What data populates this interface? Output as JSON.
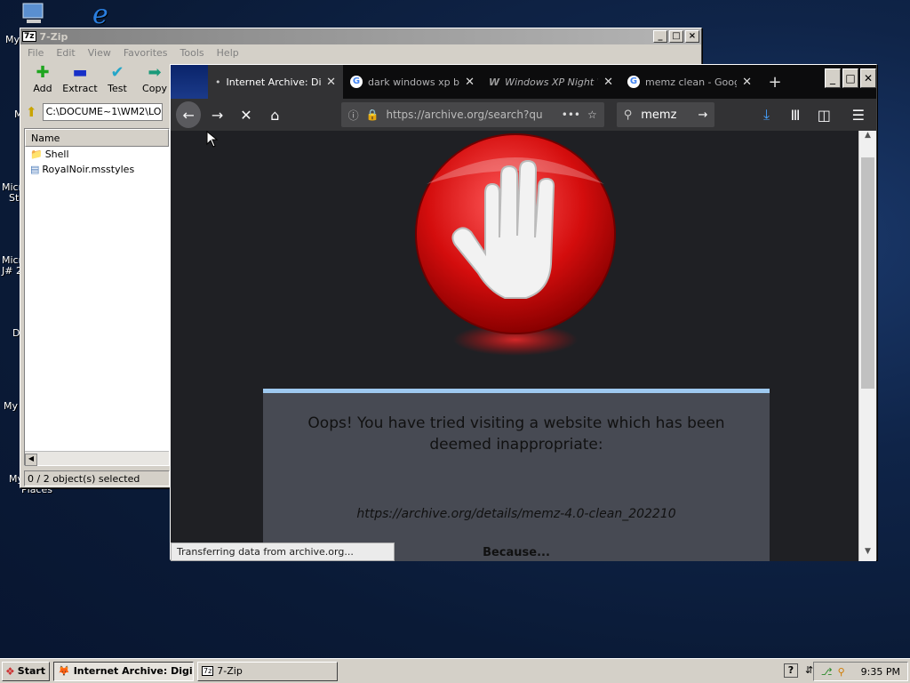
{
  "desktop": {
    "icons": [
      {
        "label": "My",
        "icon": "computer-icon"
      },
      {
        "label": "",
        "icon": "ie-icon"
      },
      {
        "label": "M"
      },
      {
        "label": "Micr"
      },
      {
        "label": "Stu"
      },
      {
        "label": "Micr"
      },
      {
        "label": "J# 2"
      },
      {
        "label": "D"
      },
      {
        "label": "My I"
      },
      {
        "label": "My"
      },
      {
        "label": "Places"
      }
    ]
  },
  "zip": {
    "title": "7-Zip",
    "menu": [
      "File",
      "Edit",
      "View",
      "Favorites",
      "Tools",
      "Help"
    ],
    "toolbar": [
      {
        "label": "Add",
        "icon": "plus-icon"
      },
      {
        "label": "Extract",
        "icon": "minus-icon"
      },
      {
        "label": "Test",
        "icon": "check-icon"
      },
      {
        "label": "Copy",
        "icon": "arrow-right-icon"
      }
    ],
    "path": "C:\\DOCUME~1\\WM2\\LO",
    "column": "Name",
    "items": [
      {
        "name": "Shell",
        "icon": "folder-icon"
      },
      {
        "name": "RoyalNoir.msstyles",
        "icon": "file-icon"
      }
    ],
    "status": "0 / 2 object(s) selected"
  },
  "firefox": {
    "tabs": [
      {
        "label": "Internet Archive: Di",
        "active": true
      },
      {
        "label": "dark windows xp ba"
      },
      {
        "label": "Windows XP Night W"
      },
      {
        "label": "memz clean - Googl"
      }
    ],
    "url": "https://archive.org/search?qu",
    "search": "memz",
    "page": {
      "heading": "Oops! You have tried visiting a website which has been deemed inappropriate:",
      "blocked_url": "https://archive.org/details/memz-4.0-clean_202210",
      "reason": "Because..."
    },
    "status": "Transferring data from archive.org..."
  },
  "taskbar": {
    "start": "Start",
    "tasks": [
      "Internet Archive: Digi...",
      "7-Zip"
    ],
    "clock": "9:35 PM"
  }
}
